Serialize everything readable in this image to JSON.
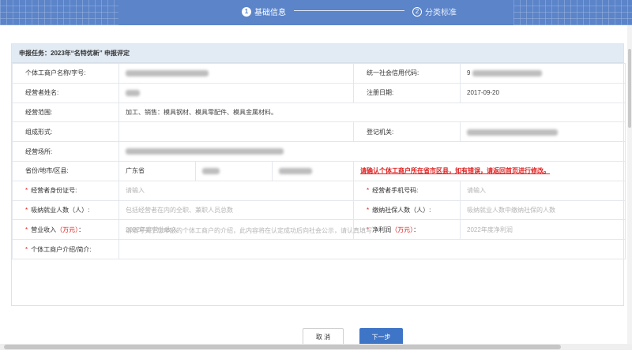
{
  "steps": [
    {
      "num": "1",
      "label": "基础信息",
      "state": "active"
    },
    {
      "num": "2",
      "label": "分类标准",
      "state": "inactive"
    }
  ],
  "panel": {
    "title": "申报任务：2023年“名特优新” 申报评定"
  },
  "form": {
    "r1": {
      "label_a": "个体工商户名称/字号:",
      "label_b": "统一社会信用代码:",
      "value_b_prefix": "9"
    },
    "r2": {
      "label_a": "经营者姓名:",
      "label_b": "注册日期:",
      "value_b": "2017-09-20"
    },
    "r3": {
      "label_a": "经营范围:",
      "value_a": "加工、销售：模具钢材、模具零配件、模具金属材料。"
    },
    "r4": {
      "label_a": "组成形式:",
      "label_b": "登记机关:"
    },
    "r5": {
      "label_a": "经营场所:"
    },
    "r6": {
      "label_a": "省份/地市/区县:",
      "province": "广东省",
      "city_prefix": "",
      "warning": "请确认个体工商户所在省市区县，如有错误，请返回首页进行修改。"
    },
    "r7": {
      "req": "*",
      "label_a": "经营者身份证号:",
      "placeholder_a": "请输入",
      "label_b": "经营者手机号码:",
      "placeholder_b": "请输入"
    },
    "r8": {
      "req": "*",
      "label_a": "吸纳就业人数（人）:",
      "placeholder_a": "包括经营者在内的全职、兼职人员总数",
      "label_b": "缴纳社保人数（人）:",
      "placeholder_b": "吸纳就业人数中缴纳社保的人数"
    },
    "r9": {
      "req": "*",
      "label_a": "营业收入",
      "unit_a": "（万元）",
      "colon": "：",
      "placeholder_a": "2022年度营业收入",
      "label_b": "净利润",
      "unit_b": "（万元）",
      "placeholder_b": "2022年度净利润"
    },
    "r10": {
      "req": "*",
      "label_a": "个体工商户介绍/简介:",
      "placeholder_a": "请填写关于您申报的个体工商户的介绍，此内容将在认定成功后向社会公示，请认真填写"
    }
  },
  "buttons": {
    "cancel": "取 消",
    "next": "下一步"
  },
  "colors": {
    "topbar": "#5b84c9",
    "primary_button": "#3f75c7",
    "required": "#e02020",
    "panel_head": "#e2ebf4"
  }
}
